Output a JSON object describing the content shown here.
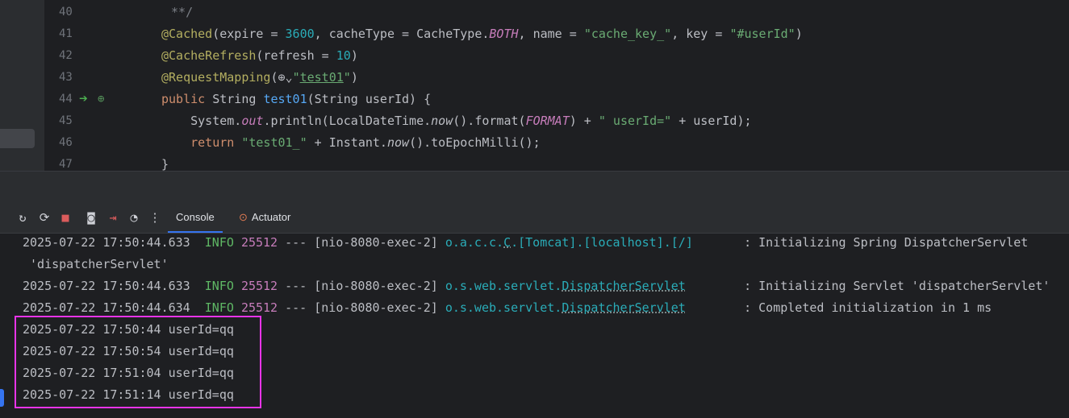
{
  "editor": {
    "line_numbers": [
      "40",
      "41",
      "42",
      "43",
      "44",
      "45",
      "46",
      "47"
    ],
    "lines": [
      {
        "segments": [
          {
            "t": " **/",
            "c": "cm"
          }
        ]
      },
      {
        "segments": [
          {
            "t": "@Cached",
            "c": "ann"
          },
          {
            "t": "(expire = ",
            "c": "def"
          },
          {
            "t": "3600",
            "c": "num"
          },
          {
            "t": ", cacheType = CacheType.",
            "c": "def"
          },
          {
            "t": "BOTH",
            "c": "itf"
          },
          {
            "t": ", name = ",
            "c": "def"
          },
          {
            "t": "\"cache_key_\"",
            "c": "str"
          },
          {
            "t": ", key = ",
            "c": "def"
          },
          {
            "t": "\"#userId\"",
            "c": "str"
          },
          {
            "t": ")",
            "c": "def"
          }
        ]
      },
      {
        "segments": [
          {
            "t": "@CacheRefresh",
            "c": "ann"
          },
          {
            "t": "(refresh = ",
            "c": "def"
          },
          {
            "t": "10",
            "c": "num"
          },
          {
            "t": ")",
            "c": "def"
          }
        ]
      },
      {
        "segments": [
          {
            "t": "@RequestMapping",
            "c": "ann"
          },
          {
            "t": "(",
            "c": "def"
          },
          {
            "t": "⊕⌄",
            "c": "def"
          },
          {
            "t": "\"",
            "c": "str"
          },
          {
            "t": "test01",
            "c": "url"
          },
          {
            "t": "\"",
            "c": "str"
          },
          {
            "t": ")",
            "c": "def"
          }
        ]
      },
      {
        "segments": [
          {
            "t": "public ",
            "c": "kw"
          },
          {
            "t": "String ",
            "c": "def"
          },
          {
            "t": "test01",
            "c": "fn"
          },
          {
            "t": "(String userId) {",
            "c": "def"
          }
        ]
      },
      {
        "segments": [
          {
            "t": "    System.",
            "c": "def"
          },
          {
            "t": "out",
            "c": "itf"
          },
          {
            "t": ".println(LocalDateTime.",
            "c": "def"
          },
          {
            "t": "now",
            "c": "it"
          },
          {
            "t": "().format(",
            "c": "def"
          },
          {
            "t": "FORMAT",
            "c": "itf"
          },
          {
            "t": ") + ",
            "c": "def"
          },
          {
            "t": "\" userId=\"",
            "c": "str"
          },
          {
            "t": " + userId);",
            "c": "def"
          }
        ]
      },
      {
        "segments": [
          {
            "t": "    ",
            "c": "def"
          },
          {
            "t": "return ",
            "c": "kw"
          },
          {
            "t": "\"test01_\"",
            "c": "str"
          },
          {
            "t": " + Instant.",
            "c": "def"
          },
          {
            "t": "now",
            "c": "it"
          },
          {
            "t": "().toEpochMilli();",
            "c": "def"
          }
        ]
      },
      {
        "segments": [
          {
            "t": "}",
            "c": "def"
          }
        ]
      }
    ]
  },
  "toolbar": {
    "icons": [
      "rerun-icon",
      "restart-icon",
      "stop-icon",
      "camera-icon",
      "exit-icon",
      "dashboard-icon",
      "more-icon"
    ],
    "tabs": {
      "console": "Console",
      "actuator": "Actuator"
    }
  },
  "console": {
    "lines": [
      {
        "segments": [
          {
            "t": "2025-07-22 17:50:44.633  ",
            "c": "def"
          },
          {
            "t": "INFO",
            "c": "lv"
          },
          {
            "t": " ",
            "c": "def"
          },
          {
            "t": "25512",
            "c": "pid"
          },
          {
            "t": " --- [nio-8080-exec-2] ",
            "c": "def"
          },
          {
            "t": "o.a.c.c.",
            "c": "logger"
          },
          {
            "t": "C",
            "c": "logger dotted"
          },
          {
            "t": ".[Tomcat].[localhost].[/]",
            "c": "logger"
          },
          {
            "t": "       : Initializing Spring DispatcherServlet",
            "c": "def"
          }
        ]
      },
      {
        "segments": [
          {
            "t": " 'dispatcherServlet'",
            "c": "def"
          }
        ]
      },
      {
        "segments": [
          {
            "t": "2025-07-22 17:50:44.633  ",
            "c": "def"
          },
          {
            "t": "INFO",
            "c": "lv"
          },
          {
            "t": " ",
            "c": "def"
          },
          {
            "t": "25512",
            "c": "pid"
          },
          {
            "t": " --- [nio-8080-exec-2] ",
            "c": "def"
          },
          {
            "t": "o.s.web.servlet.",
            "c": "logger"
          },
          {
            "t": "DispatcherServlet",
            "c": "logger dotted"
          },
          {
            "t": "        : Initializing Servlet 'dispatcherServlet'",
            "c": "def"
          }
        ]
      },
      {
        "segments": [
          {
            "t": "2025-07-22 17:50:44.634  ",
            "c": "def"
          },
          {
            "t": "INFO",
            "c": "lv"
          },
          {
            "t": " ",
            "c": "def"
          },
          {
            "t": "25512",
            "c": "pid"
          },
          {
            "t": " --- [nio-8080-exec-2] ",
            "c": "def"
          },
          {
            "t": "o.s.web.servlet.",
            "c": "logger"
          },
          {
            "t": "DispatcherServlet",
            "c": "logger dotted"
          },
          {
            "t": "        : Completed initialization in 1 ms",
            "c": "def"
          }
        ]
      },
      {
        "segments": [
          {
            "t": "2025-07-22 17:50:44 userId=qq",
            "c": "def"
          }
        ]
      },
      {
        "segments": [
          {
            "t": "2025-07-22 17:50:54 userId=qq",
            "c": "def"
          }
        ]
      },
      {
        "segments": [
          {
            "t": "2025-07-22 17:51:04 userId=qq",
            "c": "def"
          }
        ]
      },
      {
        "segments": [
          {
            "t": "2025-07-22 17:51:14 userId=qq",
            "c": "def"
          }
        ]
      }
    ]
  },
  "colors": {
    "highlight": "#e834e8",
    "accent": "#3574f0"
  }
}
